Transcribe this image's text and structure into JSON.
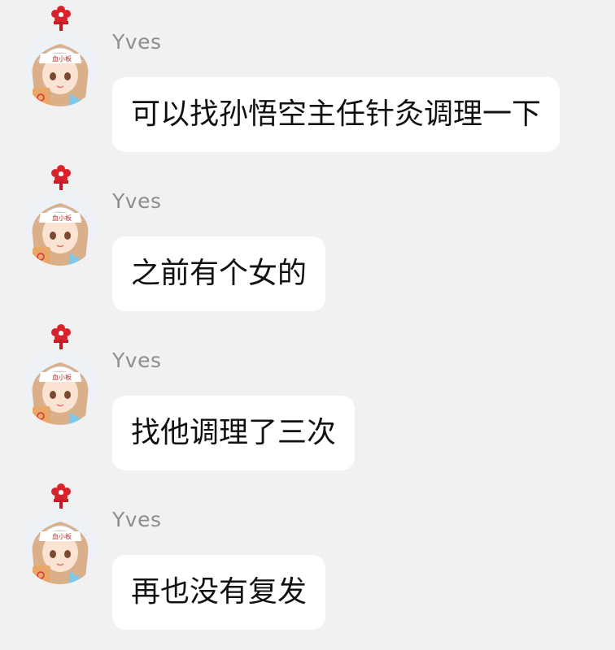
{
  "messages": [
    {
      "sender": "Yves",
      "text": "可以找孙悟空主任针灸调理一下"
    },
    {
      "sender": "Yves",
      "text": "之前有个女的"
    },
    {
      "sender": "Yves",
      "text": "找他调理了三次"
    },
    {
      "sender": "Yves",
      "text": "再也没有复发"
    }
  ],
  "colors": {
    "background": "#f2f1f1",
    "bubble": "#ffffff",
    "sender_name": "#8d8d8d",
    "message_text": "#111111",
    "flower_accent": "#d8232a"
  },
  "icons": {
    "avatar": "anime-girl-avatar-icon",
    "avatar_badge": "red-flower-icon"
  }
}
